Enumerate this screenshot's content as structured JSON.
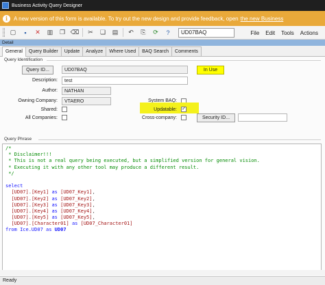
{
  "window": {
    "title": "Business Activity Query Designer"
  },
  "banner": {
    "text": "A new version of this form is available. To try out the new design and provide feedback, open",
    "link": "the new Business",
    "color": "#e9a93a"
  },
  "toolbar": {
    "query_id_value": "UD07BAQ",
    "icons": [
      "new-icon",
      "save-icon",
      "close-icon",
      "delete-icon",
      "copy-icon",
      "clear-icon",
      "cut-icon",
      "copy2-icon",
      "paste-icon",
      "undo-icon",
      "attachment-icon",
      "refresh-icon",
      "help-icon"
    ]
  },
  "menu": {
    "file": "File",
    "edit": "Edit",
    "tools": "Tools",
    "actions": "Actions"
  },
  "detail_bar": {
    "label": "Detail"
  },
  "tabs": [
    "General",
    "Query Builder",
    "Update",
    "Analyze",
    "Where Used",
    "BAQ Search",
    "Comments"
  ],
  "query_identification": {
    "group_label": "Query Identification",
    "query_id_button": "Query ID...",
    "query_id_value": "UD07BAQ",
    "in_use_button": "In Use",
    "description_label": "Description:",
    "description_value": "test",
    "author_label": "Author:",
    "author_value": "NATHAN",
    "company_label": "Owning Company:",
    "company_value": "VTAERO",
    "system_baq_label": "System BAQ:",
    "shared_label": "Shared:",
    "updatable_label": "Updatable:",
    "updatable_check": "✓",
    "all_companies_label": "All Companies:",
    "cross_company_label": "Cross-company:",
    "security_button": "Security ID..."
  },
  "query_phrase": {
    "group_label": "Query Phrase",
    "comment_lines": [
      "/*",
      " * Disclaimer!!!",
      " * This is not a real query being executed, but a simplified version for general vision.",
      " * Executing it with any other tool may produce a different result.",
      " */"
    ],
    "select_kw": "select",
    "as_kw": "as",
    "from_kw": "from",
    "columns": [
      {
        "table": "[UD07]",
        "col": "[Key1]",
        "alias": "[UD07_Key1]"
      },
      {
        "table": "[UD07]",
        "col": "[Key2]",
        "alias": "[UD07_Key2]"
      },
      {
        "table": "[UD07]",
        "col": "[Key3]",
        "alias": "[UD07_Key3]"
      },
      {
        "table": "[UD07]",
        "col": "[Key4]",
        "alias": "[UD07_Key4]"
      },
      {
        "table": "[UD07]",
        "col": "[Key5]",
        "alias": "[UD07_Key5]"
      },
      {
        "table": "[UD07]",
        "col": "[Character01]",
        "alias": "[UD07_Character01]"
      }
    ],
    "from_table": "Ice.UD07",
    "from_alias": "UD07"
  },
  "status": {
    "text": "Ready"
  }
}
